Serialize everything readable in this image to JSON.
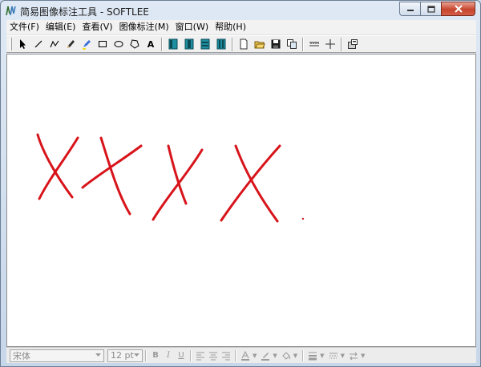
{
  "window": {
    "title": "简易图像标注工具 - SOFTLEE",
    "app_icon": "app-logo-icon"
  },
  "menubar": {
    "items": [
      {
        "label": "文件(F)"
      },
      {
        "label": "编辑(E)"
      },
      {
        "label": "查看(V)"
      },
      {
        "label": "图像标注(M)"
      },
      {
        "label": "窗口(W)"
      },
      {
        "label": "帮助(H)"
      }
    ]
  },
  "toolbar": {
    "text_tool_label": "A",
    "tools": [
      "select-arrow-icon",
      "line-icon",
      "polyline-icon",
      "pencil-icon",
      "highlighter-icon",
      "rectangle-icon",
      "ellipse-icon",
      "polygon-icon",
      "text-icon",
      "align-left-icon",
      "align-center-icon",
      "align-right-icon",
      "align-justify-icon",
      "new-file-icon",
      "open-folder-icon",
      "save-icon",
      "copy-icon",
      "ruler-icon",
      "crosshair-icon",
      "export-icon"
    ]
  },
  "canvas": {
    "background": "#ffffff",
    "stroke_color": "#d8141b",
    "marks": [
      "x-mark",
      "x-mark",
      "x-mark",
      "x-mark",
      "dot"
    ]
  },
  "formatbar": {
    "font_name": "宋体",
    "font_size": "12 pt",
    "bold_label": "B",
    "italic_label": "I",
    "underline_label": "U"
  }
}
